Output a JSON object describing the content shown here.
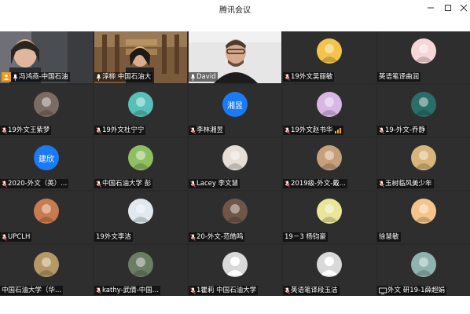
{
  "window": {
    "title": "腾讯会议"
  },
  "colors": {
    "accent_blue": "#1a7bf2",
    "active_border": "#32c36c",
    "tile_bg": "#2e2e2e",
    "grid_bg": "#2a2a2a"
  },
  "participants": [
    {
      "name": "冯鸿燕-中国石油",
      "kind": "video",
      "mic": "on",
      "active": true
    },
    {
      "name": "淳柳 中国石油大",
      "kind": "video",
      "mic": "on"
    },
    {
      "name": "David",
      "kind": "video",
      "mic": "on"
    },
    {
      "name": "19外文吴丽敏",
      "kind": "avatar",
      "mic": "muted",
      "avatar_color": "#f3c34a"
    },
    {
      "name": "英语笔译曲润",
      "kind": "avatar",
      "mic": "none",
      "avatar_color": "#f6d7d7"
    },
    {
      "name": "19外文王紫梦",
      "kind": "avatar",
      "mic": "muted",
      "avatar_color": "#7a6b63"
    },
    {
      "name": "19外文杜宁宁",
      "kind": "avatar",
      "mic": "muted",
      "avatar_color": "#57c0b8"
    },
    {
      "name": "李林湘昱",
      "kind": "initials",
      "initials": "湘昱",
      "mic": "muted"
    },
    {
      "name": "19外文赵书华",
      "kind": "avatar",
      "mic": "muted",
      "signal": true,
      "avatar_color": "#d9b7e4"
    },
    {
      "name": "19-外文-乔静",
      "kind": "avatar",
      "mic": "muted",
      "avatar_color": "#2a6e6a"
    },
    {
      "name": "2020-外文（英）...",
      "kind": "initials",
      "initials": "建欣",
      "mic": "muted"
    },
    {
      "name": "中国石油大学 彭",
      "kind": "avatar",
      "mic": "muted",
      "avatar_color": "#8fbf62"
    },
    {
      "name": "Lacey 李文慧",
      "kind": "avatar",
      "mic": "muted",
      "avatar_color": "#e7ded5"
    },
    {
      "name": "2019级-外文-戴...",
      "kind": "avatar",
      "mic": "muted",
      "avatar_color": "#c6a07a"
    },
    {
      "name": "玉树临风美少年",
      "kind": "avatar",
      "mic": "muted",
      "avatar_color": "#d8b57a"
    },
    {
      "name": "UPCLH",
      "kind": "avatar",
      "mic": "muted",
      "avatar_color": "#c97a4e"
    },
    {
      "name": "19外文李洁",
      "kind": "avatar",
      "mic": "none",
      "avatar_color": "#dfe9ef"
    },
    {
      "name": "20-外文-范皓鸣",
      "kind": "avatar",
      "mic": "muted",
      "avatar_color": "#6f5648"
    },
    {
      "name": "19－3 杨钧豪",
      "kind": "avatar",
      "mic": "none",
      "avatar_color": "#e9e59a"
    },
    {
      "name": "徐慧敏",
      "kind": "avatar",
      "mic": "none",
      "avatar_color": "#f4c58a"
    },
    {
      "name": "中国石油大学（华...",
      "kind": "avatar",
      "mic": "none",
      "avatar_color": "#b59865"
    },
    {
      "name": "kathy-武倩-中国...",
      "kind": "avatar",
      "mic": "muted",
      "avatar_color": "#6b7d63"
    },
    {
      "name": "1瞿莉 中国石油大学",
      "kind": "placeholder",
      "mic": "muted"
    },
    {
      "name": "英语笔译段玉洁",
      "kind": "placeholder",
      "mic": "muted"
    },
    {
      "name": "外文 研19-1薛超娟",
      "kind": "avatar",
      "mic": "share",
      "avatar_color": "#8fb3ae"
    }
  ]
}
